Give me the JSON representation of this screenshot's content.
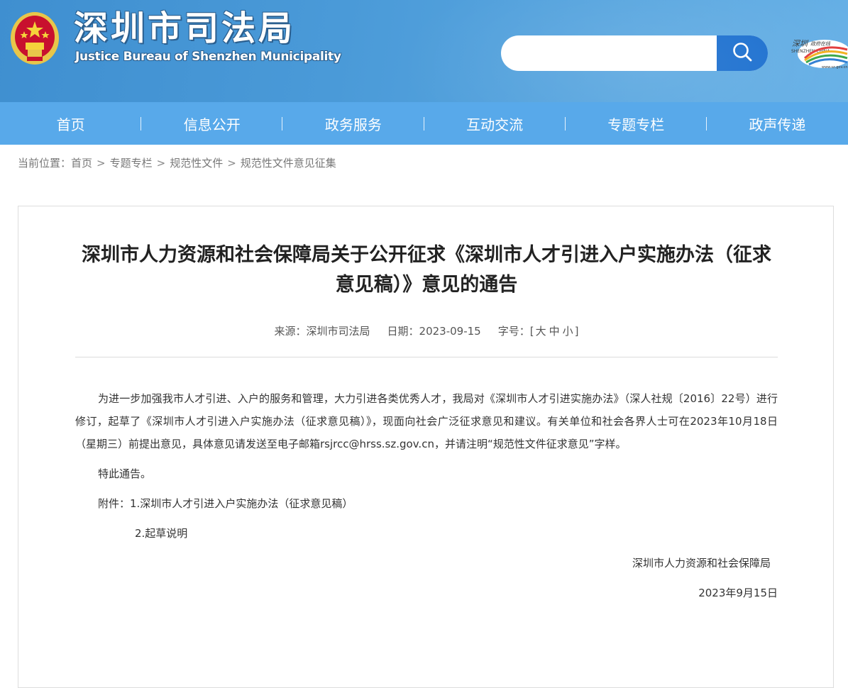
{
  "header": {
    "title": "深圳市司法局",
    "subtitle": "Justice Bureau of Shenzhen Municipality",
    "emblem_icon": "justice-emblem",
    "search": {
      "placeholder": "",
      "value": ""
    },
    "logo_icon": "shenzhen-china-gov-logo"
  },
  "nav": {
    "items": [
      {
        "label": "首页"
      },
      {
        "label": "信息公开"
      },
      {
        "label": "政务服务"
      },
      {
        "label": "互动交流"
      },
      {
        "label": "专题专栏"
      },
      {
        "label": "政声传递"
      }
    ]
  },
  "breadcrumb": {
    "prefix": "当前位置：",
    "items": [
      {
        "label": "首页"
      },
      {
        "label": "专题专栏"
      },
      {
        "label": "规范性文件"
      },
      {
        "label": "规范性文件意见征集"
      }
    ],
    "separator": ">"
  },
  "article": {
    "title": "深圳市人力资源和社会保障局关于公开征求《深圳市人才引进入户实施办法（征求意见稿）》意见的通告",
    "meta": {
      "source_label": "来源：",
      "source": "深圳市司法局",
      "date_label": "日期：",
      "date": "2023-09-15",
      "fontsize_label": "字号：",
      "fs_open": "[",
      "fs_large": "大",
      "fs_medium": "中",
      "fs_small": "小",
      "fs_close": "]"
    },
    "paragraph1": "为进一步加强我市人才引进、入户的服务和管理，大力引进各类优秀人才，我局对《深圳市人才引进实施办法》（深人社规〔2016〕22号）进行修订，起草了《深圳市人才引进入户实施办法（征求意见稿）》，现面向社会广泛征求意见和建议。有关单位和社会各界人士可在2023年10月18日（星期三）前提出意见，具体意见请发送至电子邮箱rsjrcc@hrss.sz.gov.cn，并请注明“规范性文件征求意见”字样。",
    "notice": "特此通告。",
    "attachment1": "附件：1.深圳市人才引进入户实施办法（征求意见稿）",
    "attachment2": "2.起草说明",
    "signature": "深圳市人力资源和社会保障局",
    "sign_date": "2023年9月15日"
  },
  "colors": {
    "header_blue": "#4a9ad8",
    "nav_blue": "#58a9ea",
    "search_button": "#1b6fcf"
  }
}
